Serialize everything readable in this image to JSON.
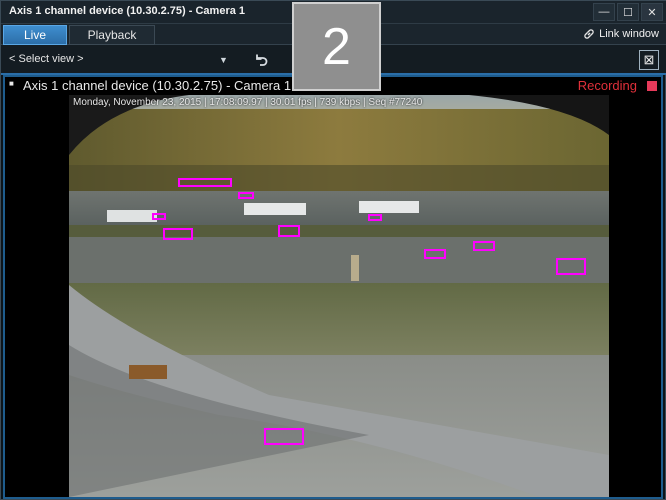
{
  "window": {
    "title": "Axis 1 channel device (10.30.2.75) - Camera 1",
    "buttons": {
      "minimize": "—",
      "maximize": "☐",
      "close": "✕"
    }
  },
  "tabs": [
    {
      "label": "Live",
      "active": true
    },
    {
      "label": "Playback",
      "active": false
    }
  ],
  "toolbar": {
    "select_view": "< Select view >",
    "link_window": "Link window"
  },
  "view_number": "2",
  "camera": {
    "title": "Axis 1 channel device (10.30.2.75) - Camera 1",
    "status": "Recording",
    "status_color": "#e0303a",
    "overlay": "Monday, November 23, 2015 | 17:08:09.97 | 30.01 fps |   739 kbps | Seq #77240"
  },
  "detection": {
    "box_color": "#ff00ff",
    "box_count": 10
  }
}
